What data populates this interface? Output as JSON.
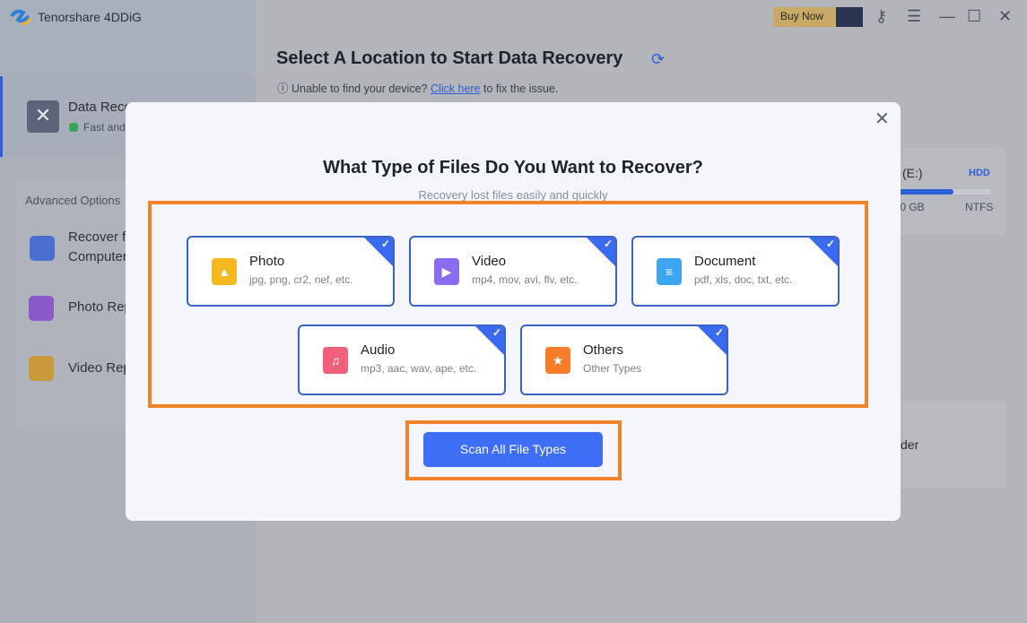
{
  "app": {
    "title": "Tenorshare 4DDiG",
    "buy_now": "Buy Now"
  },
  "sidebar": {
    "data_recovery": {
      "label": "Data Reco",
      "sub": "Fast and"
    },
    "advanced_title": "Advanced Options",
    "items": [
      {
        "label": "Recover fr",
        "label2": "Computer"
      },
      {
        "label": "Photo Rep"
      },
      {
        "label": "Video Rep"
      }
    ]
  },
  "main": {
    "title": "Select A Location to Start Data Recovery",
    "help_prefix": "Unable to find your device?",
    "help_link": "Click here",
    "help_suffix": "to fix the issue.",
    "drive": {
      "name": "(E:)",
      "type": "HDD",
      "size": ".0 GB",
      "fs": "NTFS",
      "usage_fraction": 0.6
    },
    "card2_text": "der"
  },
  "modal": {
    "title": "What Type of Files Do You Want to Recover?",
    "subtitle": "Recovery lost files easily and quickly",
    "types": [
      {
        "name": "Photo",
        "desc": "jpg, png, cr2, nef, etc.",
        "color": "#f5b920",
        "checked": true
      },
      {
        "name": "Video",
        "desc": "mp4, mov, avi, flv, etc.",
        "color": "#8b6cf0",
        "checked": true
      },
      {
        "name": "Document",
        "desc": "pdf, xls, doc, txt, etc.",
        "color": "#3ea6f0",
        "checked": true
      },
      {
        "name": "Audio",
        "desc": "mp3, aac, wav, ape, etc.",
        "color": "#f0607a",
        "checked": true
      },
      {
        "name": "Others",
        "desc": "Other Types",
        "color": "#f57c2a",
        "checked": true
      }
    ],
    "scan_button": "Scan All File Types"
  }
}
